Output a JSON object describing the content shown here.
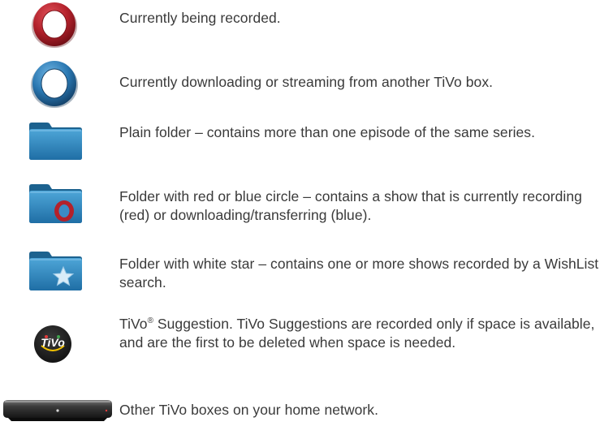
{
  "legend": {
    "items": [
      {
        "icon": "red-recording-circle-icon",
        "text": "Currently being recorded."
      },
      {
        "icon": "blue-downloading-circle-icon",
        "text": "Currently downloading or streaming from another TiVo box."
      },
      {
        "icon": "plain-folder-icon",
        "text": "Plain folder – contains more than one episode of the same series."
      },
      {
        "icon": "folder-with-red-circle-icon",
        "text": "Folder with red or blue circle – contains a show that is currently recording (red) or downloading/transferring (blue)."
      },
      {
        "icon": "folder-with-star-icon",
        "text": "Folder with white star – contains one or more shows recorded by a WishList search."
      },
      {
        "icon": "tivo-suggestion-icon",
        "text_before": "TiVo",
        "registered_mark": "®",
        "text_after": " Suggestion. TiVo Suggestions are recorded only if space is available, and are the first to be deleted when space is needed.",
        "logo_text": "TiVo"
      },
      {
        "icon": "tivo-box-icon",
        "text": "Other TiVo boxes on your home network."
      }
    ]
  },
  "colors": {
    "text": "#3a3a3a",
    "red_ring": "#b3212b",
    "blue_ring": "#2a78b2",
    "folder_blue": "#2f89c2",
    "logo_bg": "#1e1e1e"
  }
}
